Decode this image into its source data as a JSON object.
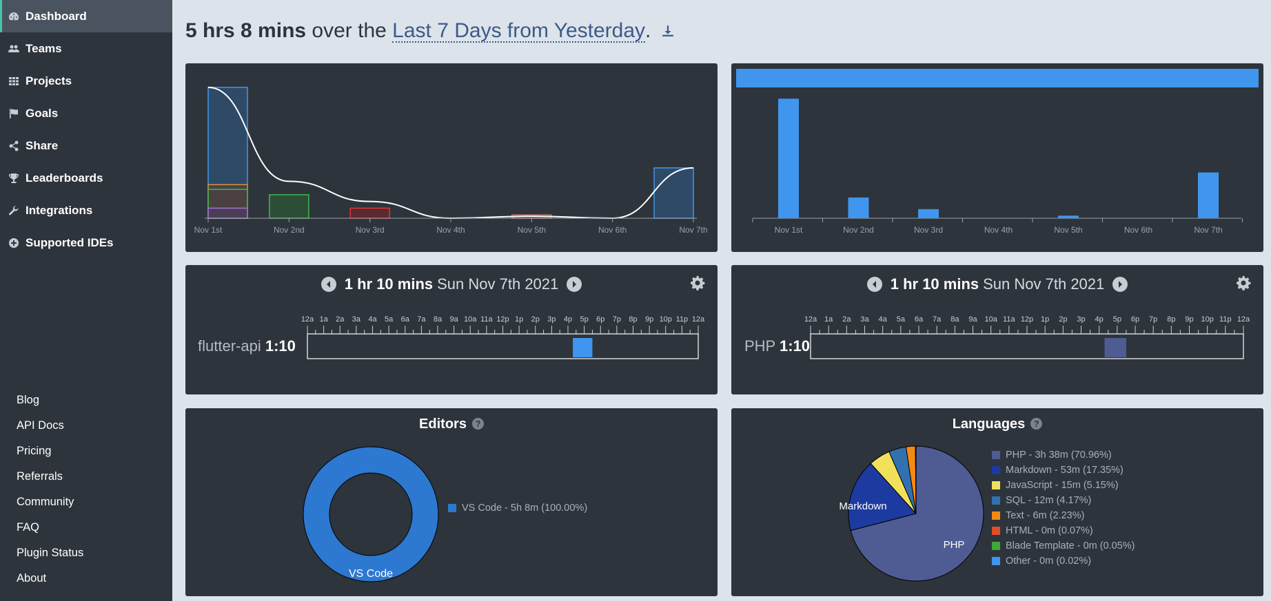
{
  "sidebar": {
    "nav": [
      {
        "label": "Dashboard",
        "icon": "dashboard-icon"
      },
      {
        "label": "Teams",
        "icon": "users-icon"
      },
      {
        "label": "Projects",
        "icon": "grid-icon"
      },
      {
        "label": "Goals",
        "icon": "flag-icon"
      },
      {
        "label": "Share",
        "icon": "share-icon"
      },
      {
        "label": "Leaderboards",
        "icon": "trophy-icon"
      },
      {
        "label": "Integrations",
        "icon": "wrench-icon"
      },
      {
        "label": "Supported IDEs",
        "icon": "plus-circle-icon"
      }
    ],
    "footer_links": [
      "Blog",
      "API Docs",
      "Pricing",
      "Referrals",
      "Community",
      "FAQ",
      "Plugin Status",
      "About"
    ]
  },
  "header": {
    "total": "5 hrs 8 mins",
    "middle": " over the ",
    "range": "Last 7 Days from Yesterday",
    "period": "."
  },
  "timeline_left": {
    "duration": "1 hr 10 mins",
    "date": "Sun Nov 7th 2021",
    "row_label": "flutter-api",
    "row_time": "1:10",
    "bar_start_hour": 16.3,
    "bar_end_hour": 17.5,
    "bar_color": "#4096ee"
  },
  "timeline_right": {
    "duration": "1 hr 10 mins",
    "date": "Sun Nov 7th 2021",
    "row_label": "PHP",
    "row_time": "1:10",
    "bar_start_hour": 16.3,
    "bar_end_hour": 17.5,
    "bar_color": "#4f5b93"
  },
  "hour_ticks": [
    "12a",
    "1a",
    "2a",
    "3a",
    "4a",
    "5a",
    "6a",
    "7a",
    "8a",
    "9a",
    "10a",
    "11a",
    "12p",
    "1p",
    "2p",
    "3p",
    "4p",
    "5p",
    "6p",
    "7p",
    "8p",
    "9p",
    "10p",
    "11p",
    "12a"
  ],
  "editors": {
    "title": "Editors",
    "donut_label": "VS Code",
    "legend": [
      {
        "label": "VS Code - 5h 8m (100.00%)",
        "color": "#2d78d0"
      }
    ]
  },
  "languages": {
    "title": "Languages",
    "slice_labels": {
      "php": "PHP",
      "markdown": "Markdown"
    },
    "legend": [
      {
        "label": "PHP - 3h 38m (70.96%)",
        "color": "#4f5b93"
      },
      {
        "label": "Markdown - 53m (17.35%)",
        "color": "#1c3aa0"
      },
      {
        "label": "JavaScript - 15m (5.15%)",
        "color": "#f1e05a"
      },
      {
        "label": "SQL - 12m (4.17%)",
        "color": "#3270b0"
      },
      {
        "label": "Text - 6m (2.23%)",
        "color": "#f48a14"
      },
      {
        "label": "HTML - 0m (0.07%)",
        "color": "#e34c26"
      },
      {
        "label": "Blade Template - 0m (0.05%)",
        "color": "#3fa83a"
      },
      {
        "label": "Other - 0m (0.02%)",
        "color": "#4096ee"
      }
    ]
  },
  "chart_data": [
    {
      "type": "bar",
      "categories": [
        "Nov 1st",
        "Nov 2nd",
        "Nov 3rd",
        "Nov 4th",
        "Nov 5th",
        "Nov 6th",
        "Nov 7th"
      ],
      "series": [
        {
          "values": [
            1.95,
            0.35,
            0.15,
            0,
            0.05,
            0,
            0.75
          ]
        },
        {
          "values": [
            0.5,
            0,
            0,
            0,
            0,
            0,
            0
          ]
        },
        {
          "values": [
            0.43,
            0,
            0,
            0,
            0,
            0,
            0
          ]
        },
        {
          "values": [
            0.15,
            0,
            0,
            0,
            0,
            0,
            0
          ]
        }
      ],
      "trend": [
        1.95,
        0.55,
        0.25,
        0,
        0.03,
        0,
        0.75
      ],
      "ylim": [
        0,
        2.0
      ]
    },
    {
      "type": "bar",
      "categories": [
        "Nov 1st",
        "Nov 2nd",
        "Nov 3rd",
        "Nov 4th",
        "Nov 5th",
        "Nov 6th",
        "Nov 7th"
      ],
      "values": [
        2.77,
        0.48,
        0.21,
        0,
        0.06,
        0,
        1.06
      ],
      "ylim": [
        0,
        2.95
      ]
    },
    {
      "type": "pie",
      "labels": [
        "VS Code"
      ],
      "values": [
        100.0
      ]
    },
    {
      "type": "pie",
      "labels": [
        "PHP",
        "Markdown",
        "JavaScript",
        "SQL",
        "Text",
        "HTML",
        "Blade Template",
        "Other"
      ],
      "values": [
        70.96,
        17.35,
        5.15,
        4.17,
        2.23,
        0.07,
        0.05,
        0.02
      ]
    }
  ]
}
